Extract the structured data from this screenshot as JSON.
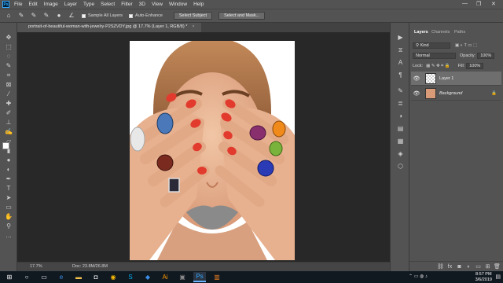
{
  "menubar": {
    "logo": "Ps",
    "items": [
      "File",
      "Edit",
      "Image",
      "Layer",
      "Type",
      "Select",
      "Filter",
      "3D",
      "View",
      "Window",
      "Help"
    ],
    "window_controls": [
      "—",
      "❐",
      "✕"
    ]
  },
  "options_bar": {
    "sample_all_layers": "Sample All Layers",
    "auto_enhance": "Auto-Enhance",
    "select_subject": "Select Subject",
    "select_and_mask": "Select and Mask..."
  },
  "document": {
    "tab_title": "portrait-of-beautiful-woman-with-jewelry-P2SZVDY.jpg @ 17.7% (Layer 1, RGB/8) *",
    "close": "×"
  },
  "status_bar": {
    "zoom": "17.7%",
    "doc": "Doc: 23.8M/26.8M"
  },
  "layers_panel": {
    "tabs": [
      "Layers",
      "Channels",
      "Paths"
    ],
    "kind": "Kind",
    "blend_mode": "Normal",
    "opacity_label": "Opacity:",
    "opacity_value": "100%",
    "lock_label": "Lock:",
    "fill_label": "Fill:",
    "fill_value": "100%",
    "layers": [
      {
        "name": "Layer 1",
        "selected": true
      },
      {
        "name": "Background",
        "selected": false
      }
    ]
  },
  "taskbar": {
    "search_placeholder": "",
    "time": "8:57 PM",
    "date": "3/6/2019"
  },
  "colors": {
    "ui_bg": "#535353",
    "canvas_bg": "#282828",
    "accent": "#31a8ff",
    "lips_overlay": "#8a8a8a",
    "nail": "#e23b2e"
  }
}
